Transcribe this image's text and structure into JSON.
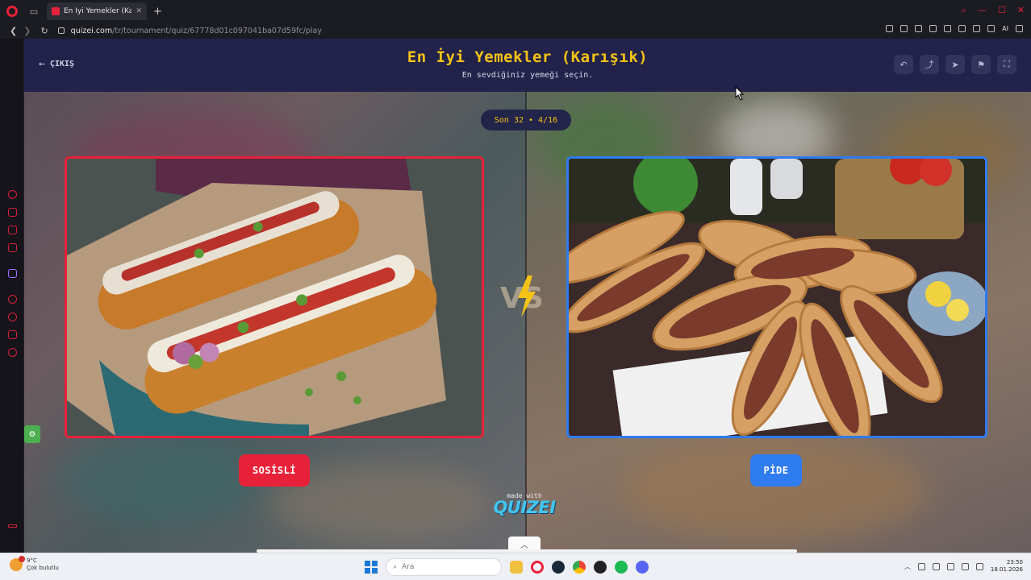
{
  "browser": {
    "tab_title": "En İyi Yemekler (Karışık)",
    "tab_close": "✕",
    "new_tab": "+",
    "url_domain": "quizei.com",
    "url_path": "/tr/tournament/quiz/67778d01c097041ba07d59fc/play",
    "ai_label": "AI"
  },
  "header": {
    "exit_label": "ÇIKIŞ",
    "title": "En İyi Yemekler (Karışık)",
    "subtitle": "En sevdiğiniz yemeği seçin.",
    "actions": [
      "undo-icon",
      "share-icon",
      "send-icon",
      "flag-icon",
      "fullscreen-icon"
    ]
  },
  "round": {
    "label": "Son 32 • 4/16"
  },
  "choices": {
    "left": {
      "label": "SOSİSLİ",
      "color": "#e8213a"
    },
    "right": {
      "label": "PİDE",
      "color": "#2f7bf0"
    }
  },
  "vs_label": "VS",
  "footer": {
    "made_with": "made with",
    "brand": "QUIZEI"
  },
  "taskbar": {
    "weather_temp": "9°C",
    "weather_desc": "Çok bulutlu",
    "search_placeholder": "Ara",
    "time": "23:50",
    "date": "18.01.2026"
  }
}
